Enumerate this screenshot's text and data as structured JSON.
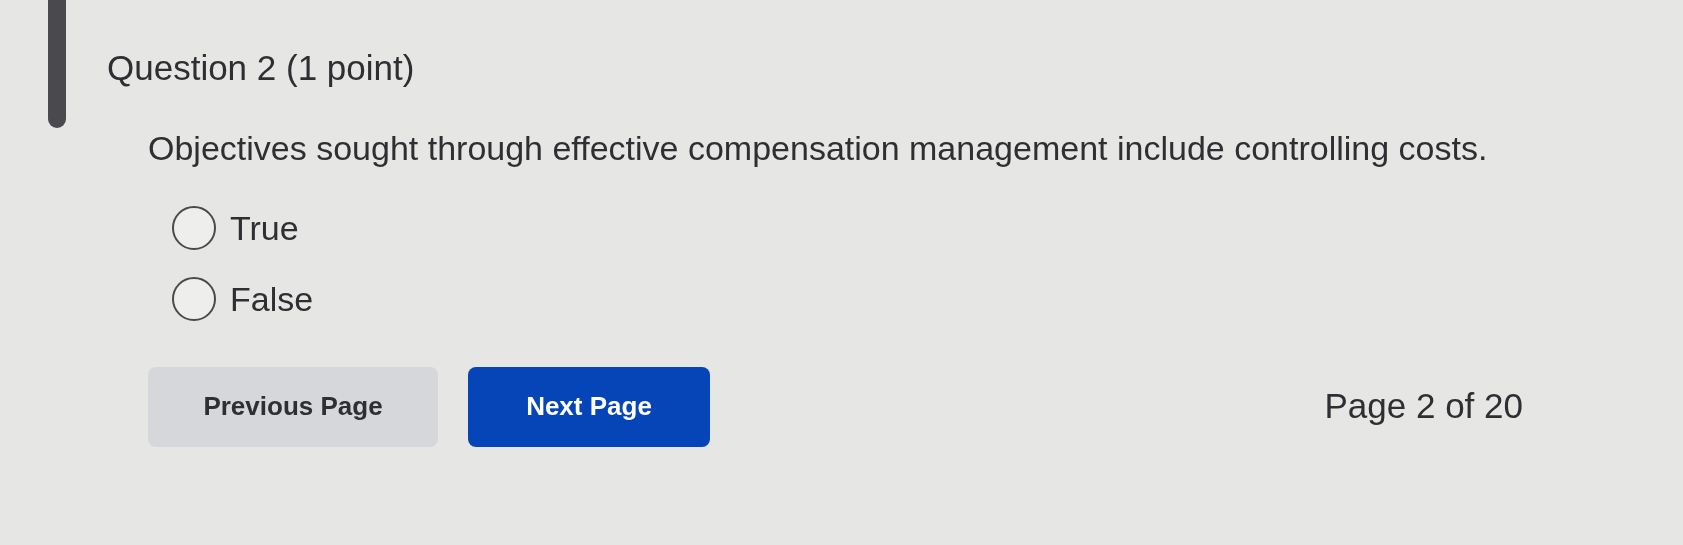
{
  "question": {
    "title": "Question 2 (1 point)",
    "text": "Objectives sought through effective compensation management include controlling costs.",
    "options": [
      {
        "label": "True",
        "selected": false
      },
      {
        "label": "False",
        "selected": false
      }
    ]
  },
  "buttons": [
    {
      "label": "Previous Page",
      "kind": "secondary"
    },
    {
      "label": "Next Page",
      "kind": "primary"
    }
  ],
  "page_indicator": "Page 2 of 20"
}
